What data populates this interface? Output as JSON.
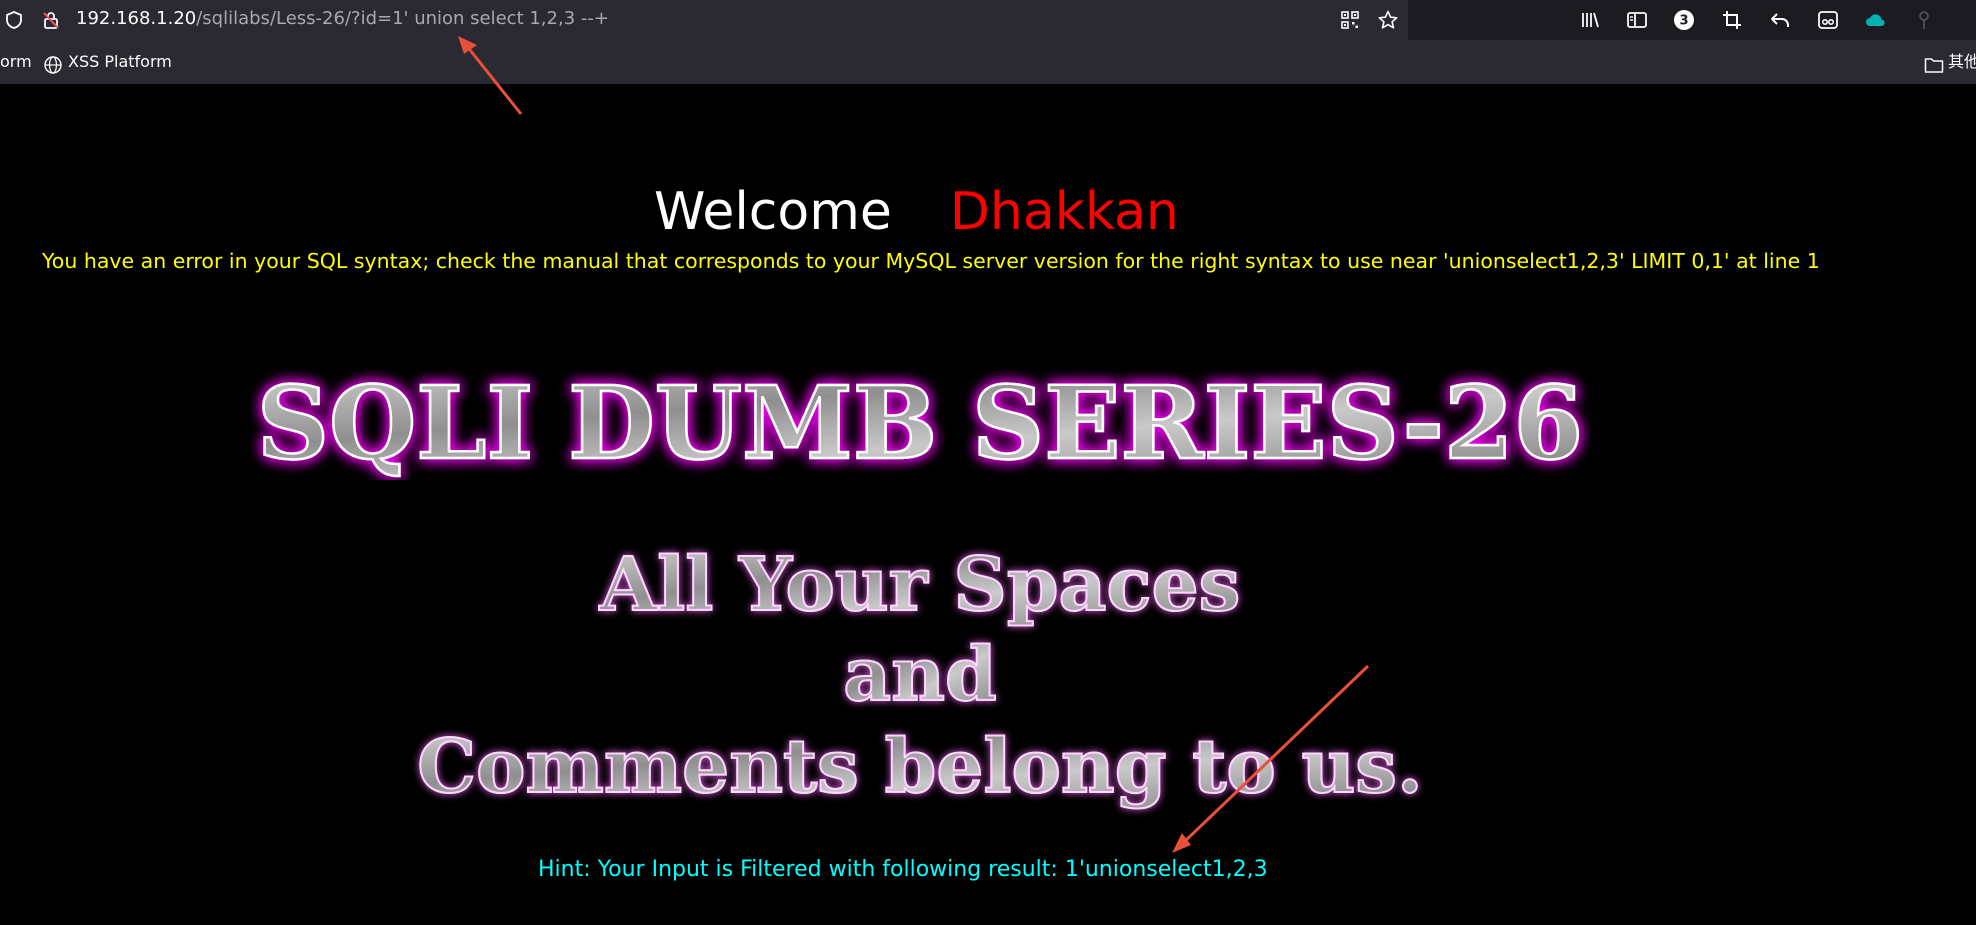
{
  "browser": {
    "url_host": "192.168.1.20",
    "url_path": "/sqlilabs/Less-26/?id=1' union select 1,2,3 --+",
    "tab_count_badge": "3",
    "bookmarks": {
      "partial_left": "orm",
      "xss_platform": "XSS Platform",
      "other_folder": "其他"
    },
    "icons": [
      "shield-icon",
      "lock-icon",
      "qr-code-icon",
      "star-icon",
      "library-icon",
      "sidebar-icon",
      "account-badge-icon",
      "crop-icon",
      "undo-icon",
      "mask-icon",
      "cloud-icon",
      "pin-icon",
      "globe-icon",
      "folder-icon"
    ],
    "accent_color": "#00b3b3"
  },
  "page": {
    "welcome_label": "Welcome",
    "welcome_name": "Dhakkan",
    "error_message": "You have an error in your SQL syntax; check the manual that corresponds to your MySQL server version for the right syntax to use near 'unionselect1,2,3' LIMIT 0,1' at line 1",
    "title_banner": "SQLI DUMB SERIES-26",
    "slogan_lines": [
      "All Your Spaces",
      "and",
      "Comments belong to us."
    ],
    "hint": "Hint: Your Input is Filtered with following result: 1'unionselect1,2,3",
    "colors": {
      "background": "#000000",
      "welcome": "#ffffff",
      "name": "#ff0000",
      "error": "#ffff00",
      "hint": "#00ffff",
      "glow": "#ff00ff",
      "annotation_arrow": "#e8503a"
    }
  }
}
